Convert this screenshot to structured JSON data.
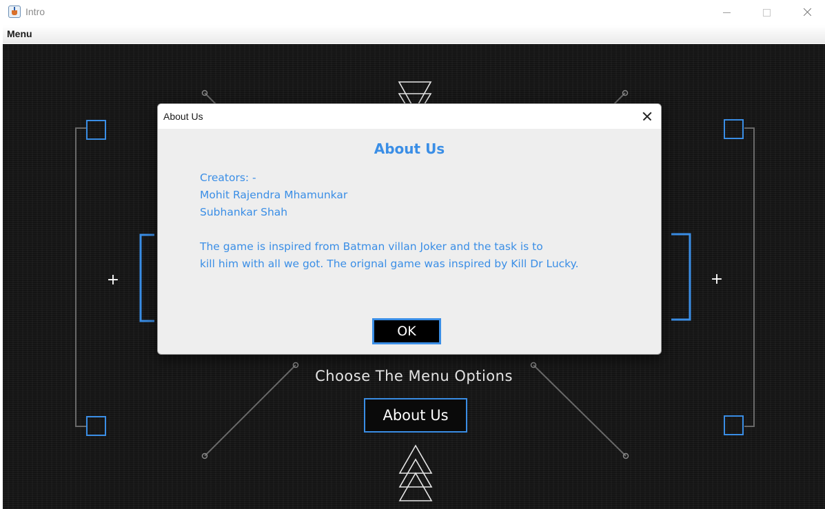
{
  "window": {
    "title": "Intro",
    "icons": [
      "java-app-icon",
      "minimize-icon",
      "maximize-icon",
      "close-icon"
    ]
  },
  "menubar": {
    "items": [
      {
        "label": "Menu"
      }
    ]
  },
  "game": {
    "prompt": "Choose The Menu Options",
    "about_button": "About Us",
    "plus_symbol": "+",
    "accent_color": "#3a8ee6",
    "background_color": "#141414"
  },
  "dialog": {
    "title": "About Us",
    "heading": "About Us",
    "lines": [
      "Creators: -",
      "Mohit Rajendra Mhamunkar",
      "Subhankar Shah",
      "The game is inspired from Batman villan Joker and the task is to",
      "kill him with all we got. The orignal game was inspired by Kill Dr Lucky."
    ],
    "ok_label": "OK",
    "text_color": "#3a8ee6"
  }
}
